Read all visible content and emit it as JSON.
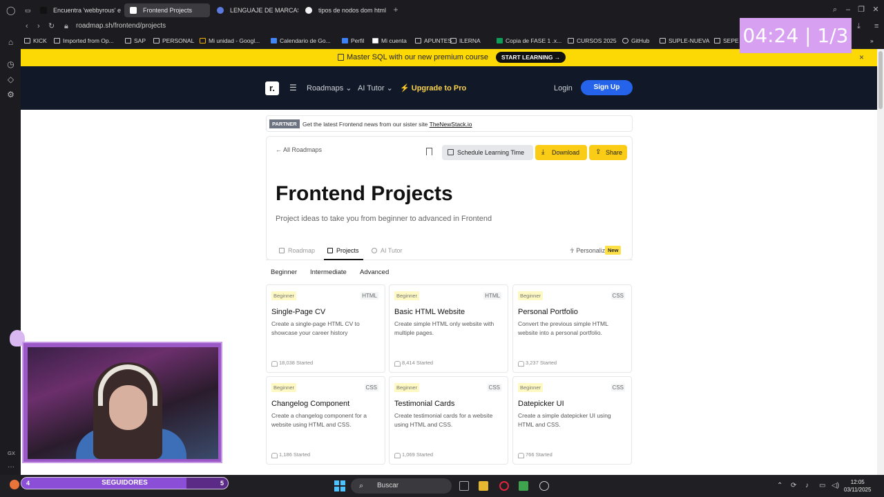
{
  "browser": {
    "tabs": [
      {
        "title": "Encuentra 'webbyrous' e",
        "color": "#111111",
        "active": false
      },
      {
        "title": "Frontend Projects",
        "color": "#ffffff",
        "active": true
      },
      {
        "title": "LENGUAJE DE MARCAS",
        "color": "#5a7ae0",
        "active": false
      },
      {
        "title": "tipos de nodos dom html",
        "color": "#f2f2f2",
        "active": false
      }
    ],
    "url": "roadmap.sh/frontend/projects",
    "bookmarks": [
      "KICK",
      "Imported from Op...",
      "SAP",
      "PERSONAL",
      "Mi unidad - Googl...",
      "Calendario de Go...",
      "Perfil",
      "Mi cuenta",
      "APUNTES",
      "ILERNA",
      "Copia de FASE 1 .x...",
      "CURSOS 2025",
      "GitHub",
      "SUPLE-NUEVA",
      "SEPE"
    ]
  },
  "banner": {
    "text": "Master SQL with our new premium course",
    "button": "START LEARNING →",
    "close": "×"
  },
  "nav": {
    "logo": "r.",
    "roadmaps": "Roadmaps ⌄",
    "ai_tutor": "AI Tutor ⌄",
    "upgrade": "⚡ Upgrade to Pro",
    "login": "Login",
    "signup": "Sign Up"
  },
  "partner": {
    "badge": "PARTNER",
    "text": "Get the latest Frontend news from our sister site",
    "link": "TheNewStack.io"
  },
  "header": {
    "back": "← All Roadmaps",
    "schedule": "Schedule Learning Time",
    "download": "Download",
    "share": "Share",
    "title": "Frontend Projects",
    "subtitle": "Project ideas to take you from beginner to advanced in Frontend"
  },
  "page_tabs": {
    "roadmap": "Roadmap",
    "projects": "Projects",
    "ai_tutor": "AI Tutor",
    "personalize": "Personalize",
    "new_badge": "New"
  },
  "levels": [
    "Beginner",
    "Intermediate",
    "Advanced"
  ],
  "projects": [
    {
      "level": "Beginner",
      "tag": "HTML",
      "title": "Single-Page CV",
      "desc": "Create a single-page HTML CV to showcase your career history",
      "started": "18,038 Started"
    },
    {
      "level": "Beginner",
      "tag": "HTML",
      "title": "Basic HTML Website",
      "desc": "Create simple HTML only website with multiple pages.",
      "started": "8,414 Started"
    },
    {
      "level": "Beginner",
      "tag": "CSS",
      "title": "Personal Portfolio",
      "desc": "Convert the previous simple HTML website into a personal portfolio.",
      "started": "3,237 Started"
    },
    {
      "level": "Beginner",
      "tag": "CSS",
      "title": "Changelog Component",
      "desc": "Create a changelog component for a website using HTML and CSS.",
      "started": "1,186 Started"
    },
    {
      "level": "Beginner",
      "tag": "CSS",
      "title": "Testimonial Cards",
      "desc": "Create testimonial cards for a website using HTML and CSS.",
      "started": "1,069 Started"
    },
    {
      "level": "Beginner",
      "tag": "CSS",
      "title": "Datepicker UI",
      "desc": "Create a simple datepicker UI using HTML and CSS.",
      "started": "766 Started"
    }
  ],
  "overlay": {
    "timer": "04:24 | 1/3",
    "followers_current": "4",
    "followers_label": "SEGUIDORES",
    "followers_goal": "5",
    "followers_progress": 0.8
  },
  "taskbar": {
    "search": "Buscar",
    "time": "12:05",
    "date": "03/11/2025"
  }
}
